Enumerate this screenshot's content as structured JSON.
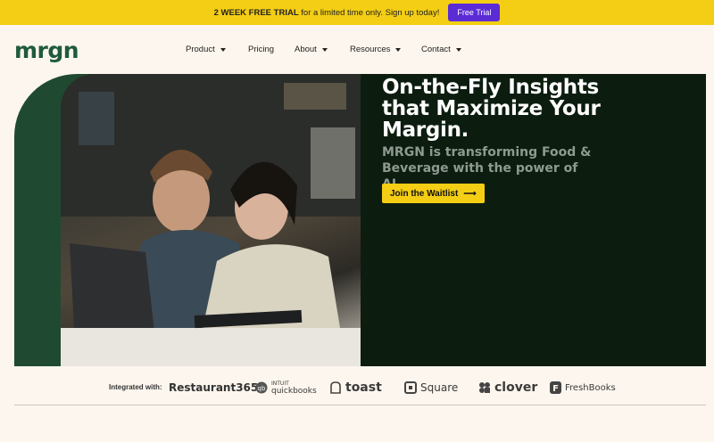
{
  "promo": {
    "bold_text": "2 WEEK FREE TRIAL",
    "text": "for a limited time only. Sign up today!",
    "button_label": "Free Trial"
  },
  "nav": {
    "logo": "mrgn",
    "items": [
      {
        "label": "Product",
        "dropdown": true
      },
      {
        "label": "Pricing",
        "dropdown": false
      },
      {
        "label": "About",
        "dropdown": true
      },
      {
        "label": "Resources",
        "dropdown": true
      },
      {
        "label": "Contact",
        "dropdown": true
      }
    ]
  },
  "hero": {
    "title": "On-the-Fly Insights that Maximize Your Margin.",
    "subtitle": "MRGN is transforming Food & Beverage with the power of AI.",
    "cta_label": "Join the Waitlist",
    "cta_arrow": "⟶"
  },
  "integrations": {
    "label": "Integrated with:",
    "brands": [
      "Restaurant365",
      "quickbooks",
      "toast",
      "Square",
      "clover",
      "FreshBooks"
    ],
    "quickbooks_prefix": "INTUIT"
  },
  "colors": {
    "accent_yellow": "#f4ce14",
    "brand_green": "#1f5a3c",
    "panel_dark": "#0c1d10",
    "purple": "#5b2bd6"
  }
}
